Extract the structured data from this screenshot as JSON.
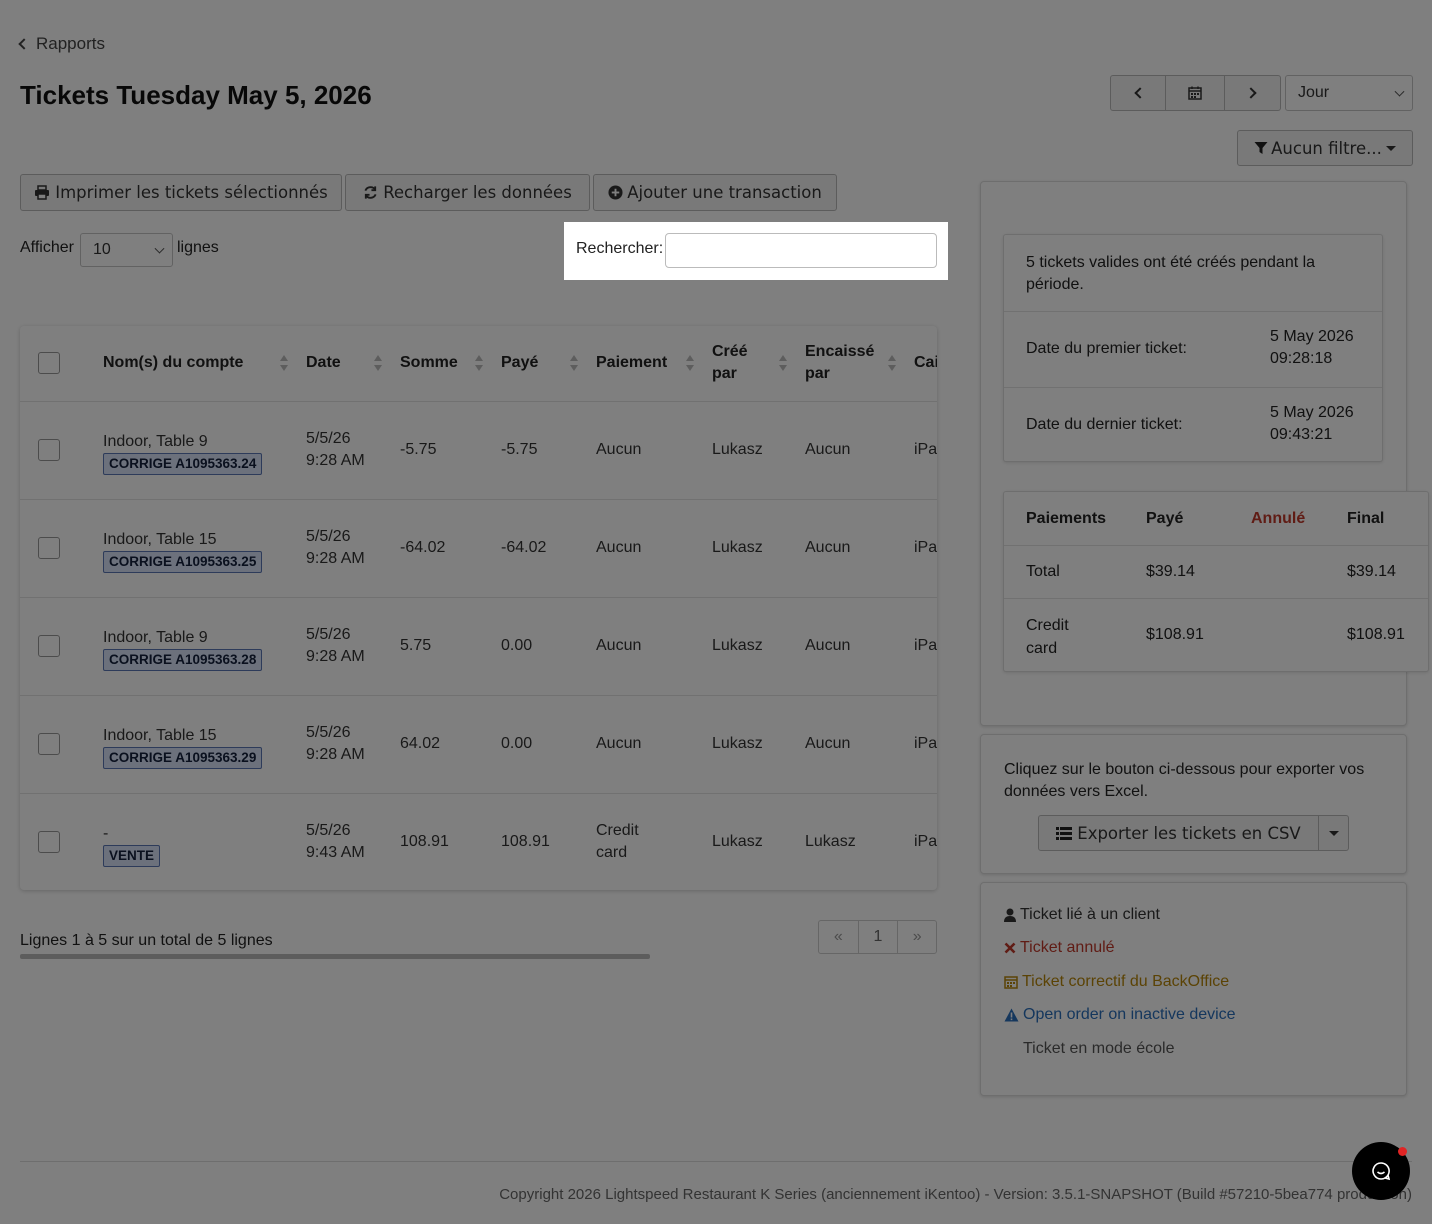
{
  "nav": {
    "back_label": "Rapports"
  },
  "page": {
    "title": "Tickets Tuesday May 5, 2026"
  },
  "date_controls": {
    "period_value": "Jour"
  },
  "filter": {
    "label": "Aucun filtre..."
  },
  "toolbar": {
    "print_label": "Imprimer les tickets sélectionnés",
    "reload_label": "Recharger les données",
    "add_label": "Ajouter une transaction"
  },
  "length": {
    "prefix": "Afficher",
    "value": "10",
    "suffix": "lignes"
  },
  "search": {
    "label": "Rechercher:",
    "value": ""
  },
  "table": {
    "columns": [
      "Nom(s) du compte",
      "Date",
      "Somme",
      "Payé",
      "Paiement",
      "Créé par",
      "Encaissé par",
      "Caisse"
    ],
    "rows": [
      {
        "name": "Indoor, Table 9",
        "badge": "CORRIGE A1095363.24",
        "date": "5/5/26 9:28 AM",
        "amount": "-5.75",
        "paid": "-5.75",
        "payment": "Aucun",
        "created": "Lukasz",
        "cashed": "Aucun",
        "register": "iPad"
      },
      {
        "name": "Indoor, Table 15",
        "badge": "CORRIGE A1095363.25",
        "date": "5/5/26 9:28 AM",
        "amount": "-64.02",
        "paid": "-64.02",
        "payment": "Aucun",
        "created": "Lukasz",
        "cashed": "Aucun",
        "register": "iPad"
      },
      {
        "name": "Indoor, Table 9",
        "badge": "CORRIGE A1095363.28",
        "date": "5/5/26 9:28 AM",
        "amount": "5.75",
        "paid": "0.00",
        "payment": "Aucun",
        "created": "Lukasz",
        "cashed": "Aucun",
        "register": "iPad"
      },
      {
        "name": "Indoor, Table 15",
        "badge": "CORRIGE A1095363.29",
        "date": "5/5/26 9:28 AM",
        "amount": "64.02",
        "paid": "0.00",
        "payment": "Aucun",
        "created": "Lukasz",
        "cashed": "Aucun",
        "register": "iPad"
      },
      {
        "name": "-",
        "badge": "VENTE",
        "date": "5/5/26 9:43 AM",
        "amount": "108.91",
        "paid": "108.91",
        "payment": "Credit card",
        "created": "Lukasz",
        "cashed": "Lukasz",
        "register": "iPad"
      }
    ]
  },
  "pagination": {
    "info": "Lignes 1 à 5 sur un total de 5 lignes",
    "prev": "«",
    "page": "1",
    "next": "»"
  },
  "summary": {
    "intro": "5 tickets valides ont été créés pendant la période.",
    "first_label": "Date du premier ticket:",
    "first_date": "5 May 2026",
    "first_time": "09:28:18",
    "last_label": "Date du dernier ticket:",
    "last_date": "5 May 2026",
    "last_time": "09:43:21"
  },
  "payments": {
    "headers": [
      "Paiements",
      "Payé",
      "Annulé",
      "Final"
    ],
    "rows": [
      {
        "label": "Total",
        "paid": "$39.14",
        "cancelled": "",
        "final": "$39.14"
      },
      {
        "label": "Credit card",
        "paid": "$108.91",
        "cancelled": "",
        "final": "$108.91"
      }
    ]
  },
  "export": {
    "text": "Cliquez sur le bouton ci-dessous pour exporter vos données vers Excel.",
    "button_label": "Exporter les tickets en CSV"
  },
  "legend": {
    "client": "Ticket lié à un client",
    "cancelled": "Ticket annulé",
    "backoffice": "Ticket correctif du BackOffice",
    "inactive": "Open order on inactive device",
    "school": "Ticket en mode école"
  },
  "footer": {
    "copyright": "Copyright 2026 Lightspeed Restaurant K Series (anciennement iKentoo) - Version: 3.5.1-SNAPSHOT (Build #57210-5bea774 production)"
  },
  "colors": {
    "cancelled": "#c0392b",
    "backoffice": "#b7860b",
    "inactive": "#2a6ebb",
    "badge_bg": "#d8e3f8"
  }
}
